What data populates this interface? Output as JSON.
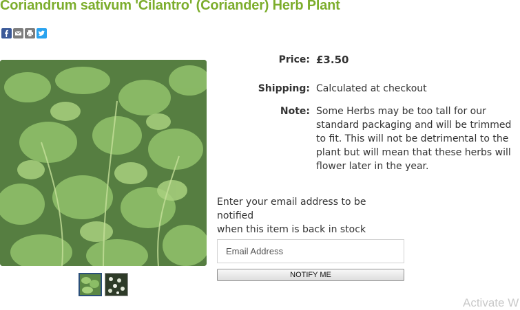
{
  "product": {
    "title": "Coriandrum sativum 'Cilantro' (Coriander) Herb Plant",
    "image_alt": "Coriander plant leaves"
  },
  "share_icons": [
    "facebook-icon",
    "email-icon",
    "print-icon",
    "twitter-icon"
  ],
  "details": {
    "price_label": "Price:",
    "price_value": "£3.50",
    "shipping_label": "Shipping:",
    "shipping_value": "Calculated at checkout",
    "note_label": "Note:",
    "note_value": "Some Herbs may be too tall for our standard packaging and will be trimmed to fit. This will not be detrimental to the plant but will mean that these herbs will flower later in the year."
  },
  "notify": {
    "line1": "Enter your email address to be notified",
    "line2": "when this item is back in stock",
    "email_placeholder": "Email Address",
    "button_label": "NOTIFY ME"
  },
  "watermark": "Activate W",
  "colors": {
    "title": "#7cad2c",
    "facebook": "#3b5998",
    "twitter": "#2aa3ef",
    "thumb_active_border": "#2a4f79"
  }
}
